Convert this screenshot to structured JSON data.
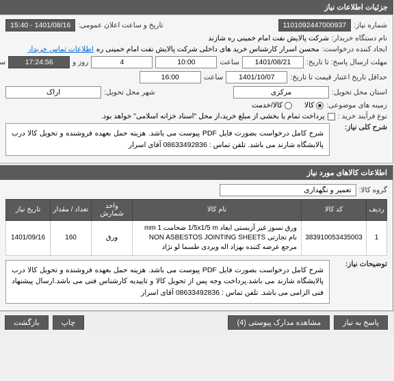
{
  "header": {
    "title": "جزئیات اطلاعات نیاز"
  },
  "fields": {
    "needNumber_label": "شماره نیاز:",
    "needNumber_value": "1101092447000937",
    "announceDate_label": "تاریخ و ساعت اعلان عمومی:",
    "announceDate_value": "1401/08/16 - 15:40",
    "buyerOrg_label": "نام دستگاه خریدار:",
    "buyerOrg_value": "شرکت پالایش نفت امام خمینی  ره  شازند",
    "requester_label": "ایجاد کننده درخواست:",
    "requester_value": "محسن  اسرار کارشناس خرید های داخلی  شرکت پالایش نفت امام خمینی  ره",
    "contactInfo_link": "اطلاعات تماس خریدار",
    "deadline_label": "مهلت ارسال پاسخ: تا تاریخ:",
    "deadline_date": "1401/08/21",
    "hourLabel": "ساعت",
    "deadline_hour": "10:00",
    "daysLeft_value": "4",
    "daysLeft_label": "روز و",
    "time_left": "17:24:56",
    "remaining_label": "ساعت باقی مانده",
    "expiry_label": "حداقل تاریخ اعتبار قیمت تا تاریخ:",
    "expiry_date": "1401/10/07",
    "expiry_hour": "16:00",
    "province_label": "استان محل تحویل:",
    "province_value": "مرکزی",
    "city_label": "شهر محل تحویل:",
    "city_value": "اراک",
    "subject_label": "زمینه های موضوعی:",
    "subject_opt1": "کالا",
    "subject_opt2": "کالا/خدمت",
    "buyType_label": "نوع فرآیند خرید :",
    "pay_text": "پرداخت تمام یا بخشی از مبلغ خرید،از محل \"اسناد خزانه اسلامی\" خواهد بود."
  },
  "desc": {
    "title": "شرح کلی نیاز:",
    "text": "شرح کامل درخواست بصورت فایل PDF پیوست می باشد. هزینه حمل بعهده فروشنده و تحویل کالا درب پالایشگاه شازند می باشد. تلفن تماس : 08633492836 آقای اسرار"
  },
  "goods": {
    "title": "اطلاعات کالاهای مورد نیاز",
    "group_label": "گروه کالا:",
    "group_value": "تعمیر و نگهداری"
  },
  "table": {
    "headers": [
      "ردیف",
      "کد کالا",
      "نام کالا",
      "واحد شمارش",
      "تعداد / مقدار",
      "تاریخ نیاز"
    ],
    "rows": [
      {
        "idx": "1",
        "code": "383910053435003",
        "name": "ورق نسوز غیر آزبستی ابعاد 1/5x1/5 m ضخامت 1 mm نام تجارتی NON ASBESTOS JOINTING SHEETS مرجع عرضه کننده بهزاد اله ویردی طسما لو نژاد",
        "unit": "ورق",
        "qty": "160",
        "date": "1401/09/16"
      }
    ]
  },
  "notes": {
    "label": "توضیحات نیاز:",
    "text": "شرح کامل درخواست بصورت فایل PDF پیوست می باشد. هزینه حمل بعهده فروشنده و تحویل کالا درب پالایشگاه شازند می باشد.پرداخت وجه پس از تحویل کالا و تاییدیه کارشناس فنی می باشد.ارسال پیشنهاد فنی الزامی می باشد. تلفن تماس : 08633492836 آقای اسرار"
  },
  "buttons": {
    "reply": "پاسخ به نیاز",
    "attachments": "مشاهده مدارک پیوستی (4)",
    "return": "بازگشت",
    "print": "چاپ"
  }
}
